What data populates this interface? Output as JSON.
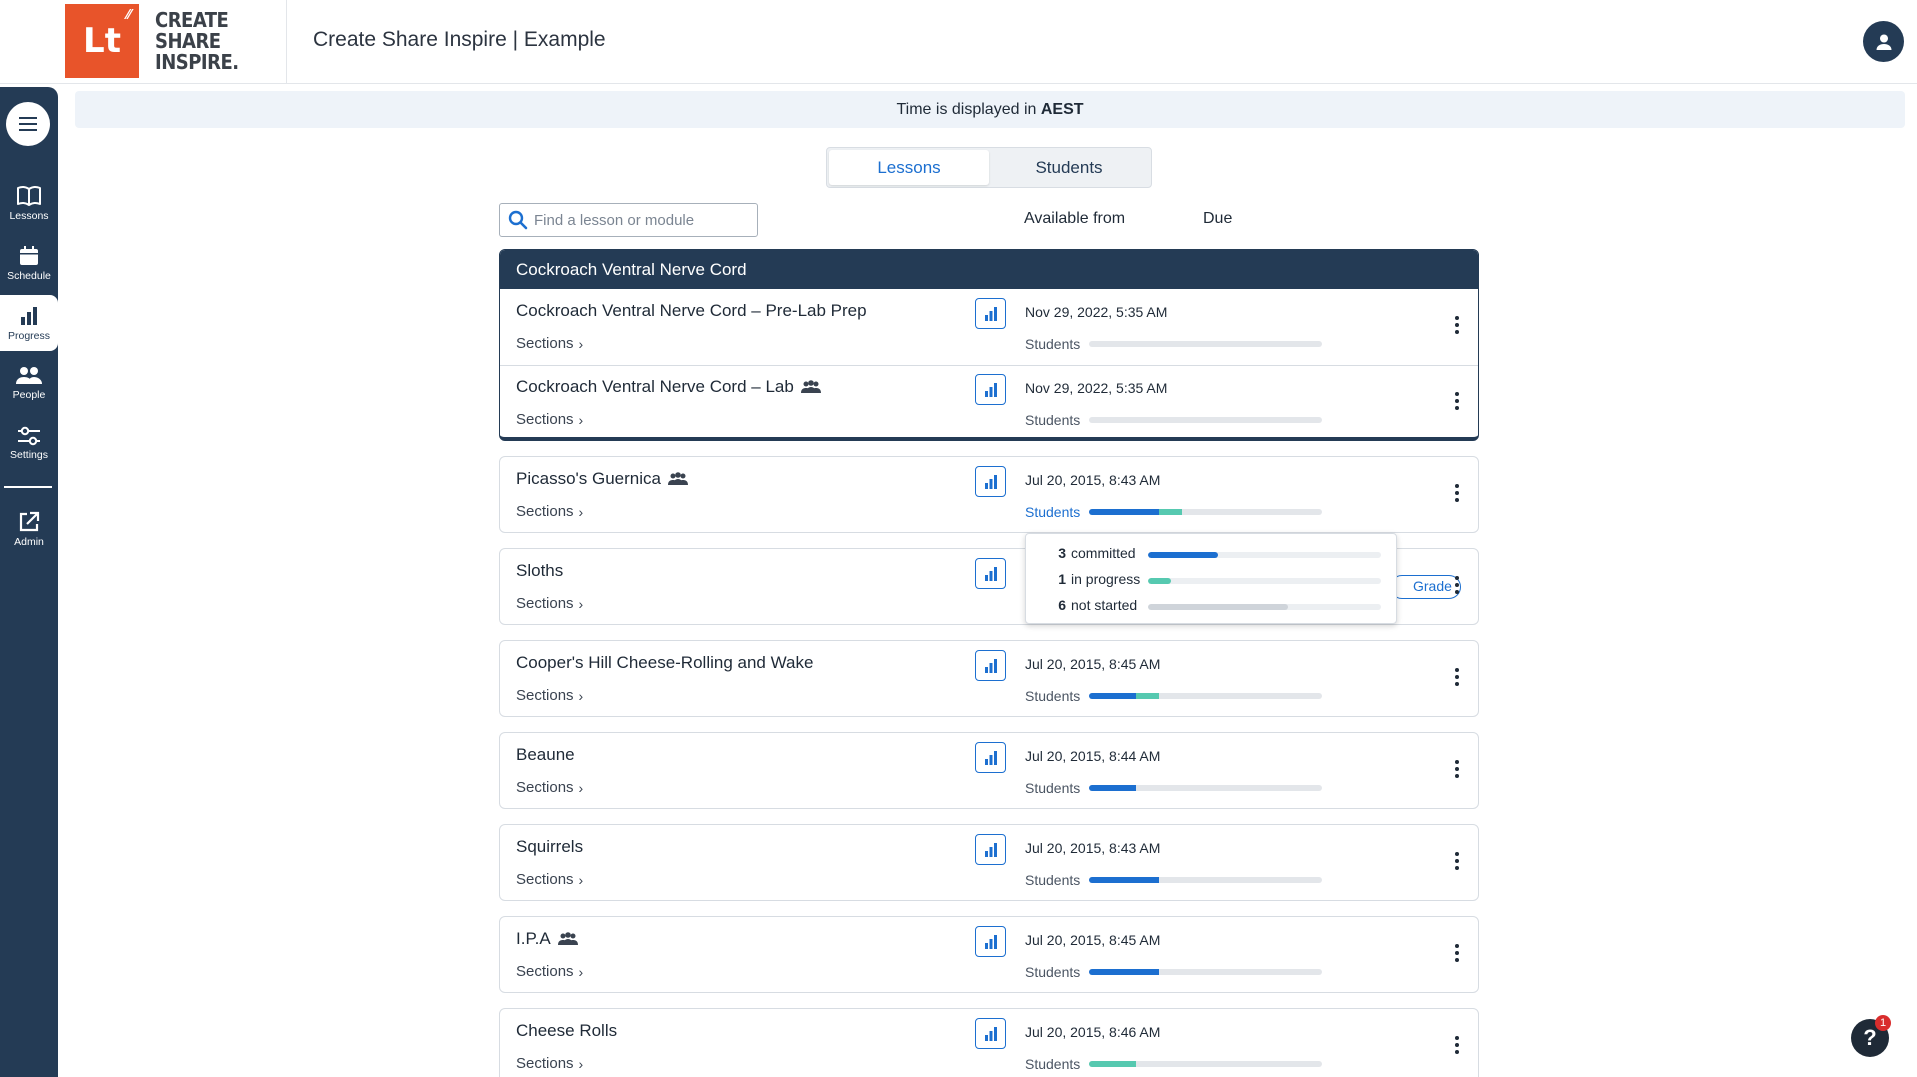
{
  "header": {
    "logo_mark": "Lt",
    "logo_words": [
      "CREATE",
      "SHARE",
      "INSPIRE."
    ],
    "title": "Create Share Inspire | Example"
  },
  "sidebar": {
    "items": [
      {
        "label": "Lessons",
        "icon": "book-icon"
      },
      {
        "label": "Schedule",
        "icon": "calendar-icon"
      },
      {
        "label": "Progress",
        "icon": "bar-chart-icon",
        "active": true
      },
      {
        "label": "People",
        "icon": "people-icon"
      },
      {
        "label": "Settings",
        "icon": "sliders-icon"
      },
      {
        "label": "Admin",
        "icon": "external-link-icon"
      }
    ]
  },
  "banner": {
    "prefix": "Time is displayed in ",
    "zone": "AEST"
  },
  "tabs": [
    {
      "label": "Lessons",
      "active": true
    },
    {
      "label": "Students",
      "active": false
    }
  ],
  "search": {
    "placeholder": "Find a lesson or module",
    "value": ""
  },
  "columns": {
    "available_from": "Available from",
    "due": "Due"
  },
  "sections_label": "Sections",
  "students_label": "Students",
  "module": {
    "title": "Cockroach Ventral Nerve Cord",
    "lessons": [
      {
        "title": "Cockroach Ventral Nerve Cord – Pre-Lab Prep",
        "group": false,
        "available": "Nov 29, 2022, 5:35 AM",
        "committed_pct": 0,
        "progress_pct": 0
      },
      {
        "title": "Cockroach Ventral Nerve Cord – Lab",
        "group": true,
        "available": "Nov 29, 2022, 5:35 AM",
        "committed_pct": 0,
        "progress_pct": 0
      }
    ]
  },
  "lessons": [
    {
      "title": "Picasso's Guernica",
      "group": true,
      "available": "Jul 20, 2015, 8:43 AM",
      "committed_pct": 30,
      "progress_pct": 10,
      "students_link": true
    },
    {
      "title": "Sloths",
      "group": false,
      "available": "",
      "committed_pct": 0,
      "progress_pct": 0,
      "grade_label": "Grade"
    },
    {
      "title": "Cooper's Hill Cheese-Rolling and Wake",
      "group": false,
      "available": "Jul 20, 2015, 8:45 AM",
      "committed_pct": 20,
      "progress_pct": 10
    },
    {
      "title": "Beaune",
      "group": false,
      "available": "Jul 20, 2015, 8:44 AM",
      "committed_pct": 20,
      "progress_pct": 0
    },
    {
      "title": "Squirrels",
      "group": false,
      "available": "Jul 20, 2015, 8:43 AM",
      "committed_pct": 30,
      "progress_pct": 0
    },
    {
      "title": "I.P.A",
      "group": true,
      "available": "Jul 20, 2015, 8:45 AM",
      "committed_pct": 30,
      "progress_pct": 0
    },
    {
      "title": "Cheese Rolls",
      "group": false,
      "available": "Jul 20, 2015, 8:46 AM",
      "committed_pct": 0,
      "progress_pct": 20
    }
  ],
  "popover": {
    "rows": [
      {
        "count": "3",
        "label": "committed",
        "pct": 30,
        "color": "#1c6fd0"
      },
      {
        "count": "1",
        "label": "in progress",
        "pct": 10,
        "color": "#56c9b0"
      },
      {
        "count": "6",
        "label": "not started",
        "pct": 60,
        "color": "#cfd4da"
      }
    ]
  },
  "help": {
    "label": "?",
    "badge": "1"
  },
  "colors": {
    "navy": "#243b55",
    "accent": "#1c6fd0",
    "teal": "#56c9b0",
    "brand": "#e8542a"
  }
}
